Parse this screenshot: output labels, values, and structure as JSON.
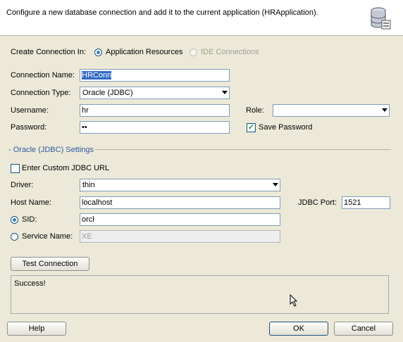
{
  "header": {
    "text": "Configure a new database connection and add it to the current application (HRApplication).",
    "icon": "database-icon"
  },
  "create_in": {
    "label": "Create Connection In:",
    "option1": "Application Resources",
    "option2": "IDE Connections"
  },
  "connection_name": {
    "label": "Connection Name:",
    "value": "HRConn"
  },
  "connection_type": {
    "label": "Connection Type:",
    "value": "Oracle (JDBC)"
  },
  "username": {
    "label": "Username:",
    "value": "hr"
  },
  "role": {
    "label": "Role:",
    "value": ""
  },
  "password": {
    "label": "Password:",
    "value": "••"
  },
  "save_password": {
    "label": "Save Password",
    "checked": true
  },
  "jdbc_settings": {
    "label": "Oracle (JDBC) Settings"
  },
  "custom_url": {
    "label": "Enter Custom JDBC URL",
    "checked": false
  },
  "driver": {
    "label": "Driver:",
    "value": "thin"
  },
  "host": {
    "label": "Host Name:",
    "value": "localhost"
  },
  "jdbc_port": {
    "label": "JDBC Port:",
    "value": "1521"
  },
  "sid": {
    "label": "SID:",
    "value": "orcl"
  },
  "service_name": {
    "label": "Service Name:",
    "value": "XE"
  },
  "test_button": "Test Connection",
  "output": "Success!",
  "buttons": {
    "help": "Help",
    "ok": "OK",
    "cancel": "Cancel"
  },
  "colors": {
    "accent": "#316ac5",
    "section": "#2c5aa0",
    "dialog_bg": "#ece9d8"
  }
}
